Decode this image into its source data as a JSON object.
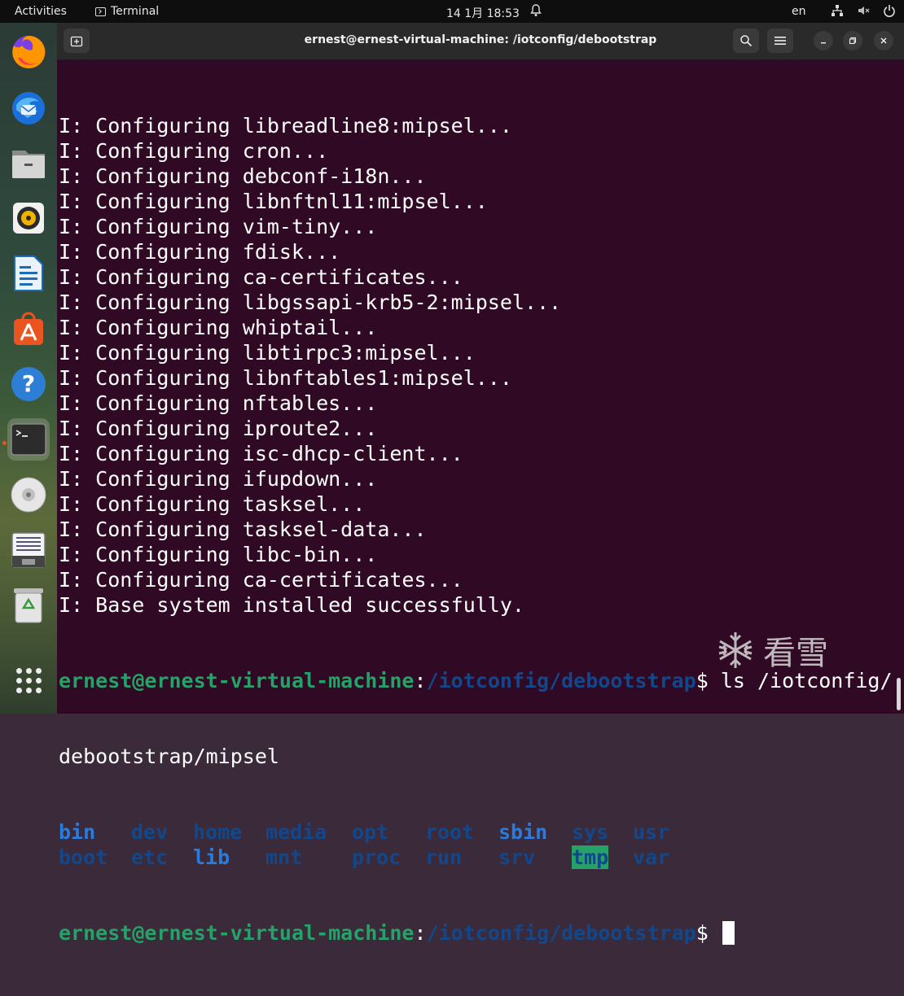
{
  "topbar": {
    "activities": "Activities",
    "app_name": "Terminal",
    "clock": "14 1月  18:53",
    "language": "en"
  },
  "dock": {
    "items": [
      {
        "name": "firefox-icon"
      },
      {
        "name": "thunderbird-icon"
      },
      {
        "name": "files-icon"
      },
      {
        "name": "rhythmbox-icon"
      },
      {
        "name": "libreoffice-writer-icon"
      },
      {
        "name": "app-center-icon"
      },
      {
        "name": "help-icon"
      },
      {
        "name": "terminal-icon",
        "active": true
      },
      {
        "name": "disc-icon"
      },
      {
        "name": "save-drive-icon"
      },
      {
        "name": "trash-icon"
      },
      {
        "name": "show-apps-icon"
      }
    ]
  },
  "window": {
    "title": "ernest@ernest-virtual-machine: /iotconfig/debootstrap"
  },
  "terminal": {
    "lines": [
      "I: Configuring libreadline8:mipsel...",
      "I: Configuring cron...",
      "I: Configuring debconf-i18n...",
      "I: Configuring libnftnl11:mipsel...",
      "I: Configuring vim-tiny...",
      "I: Configuring fdisk...",
      "I: Configuring ca-certificates...",
      "I: Configuring libgssapi-krb5-2:mipsel...",
      "I: Configuring whiptail...",
      "I: Configuring libtirpc3:mipsel...",
      "I: Configuring libnftables1:mipsel...",
      "I: Configuring nftables...",
      "I: Configuring iproute2...",
      "I: Configuring isc-dhcp-client...",
      "I: Configuring ifupdown...",
      "I: Configuring tasksel...",
      "I: Configuring tasksel-data...",
      "I: Configuring libc-bin...",
      "I: Configuring ca-certificates...",
      "I: Base system installed successfully."
    ],
    "prompt_user": "ernest@ernest-virtual-machine",
    "prompt_colon": ":",
    "prompt_path": "/iotconfig/debootstrap",
    "prompt_dollar": "$ ",
    "command": "ls /iotconfig/",
    "command_wrap": "debootstrap/mipsel",
    "ls_rows": [
      [
        {
          "name": "bin",
          "type": "link"
        },
        {
          "name": "dev",
          "type": "dir"
        },
        {
          "name": "home",
          "type": "dir"
        },
        {
          "name": "media",
          "type": "dir"
        },
        {
          "name": "opt",
          "type": "dir"
        },
        {
          "name": "root",
          "type": "dir"
        },
        {
          "name": "sbin",
          "type": "link"
        },
        {
          "name": "sys",
          "type": "dir"
        },
        {
          "name": "usr",
          "type": "dir"
        }
      ],
      [
        {
          "name": "boot",
          "type": "dir"
        },
        {
          "name": "etc",
          "type": "dir"
        },
        {
          "name": "lib",
          "type": "link"
        },
        {
          "name": "mnt",
          "type": "dir"
        },
        {
          "name": "proc",
          "type": "dir"
        },
        {
          "name": "run",
          "type": "dir"
        },
        {
          "name": "srv",
          "type": "dir"
        },
        {
          "name": "tmp",
          "type": "tmpdir"
        },
        {
          "name": "var",
          "type": "dir"
        }
      ]
    ]
  },
  "watermark": {
    "text": "看雪"
  }
}
